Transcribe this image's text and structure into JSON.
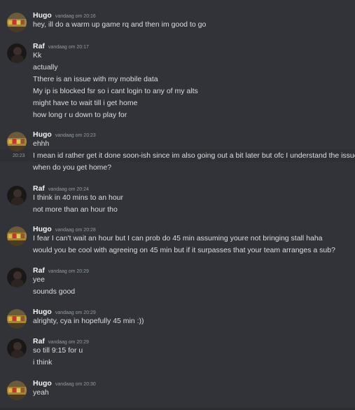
{
  "users": {
    "hugo": {
      "name": "Hugo",
      "avatar_icon": "hugo-avatar-icon"
    },
    "raf": {
      "name": "Raf",
      "avatar_icon": "raf-avatar-icon"
    }
  },
  "messages": [
    {
      "author": "Hugo",
      "timestamp": "vandaag om 20:16",
      "lines": [
        "hey, ill do a warm up game rq and then im good to go"
      ]
    },
    {
      "author": "Raf",
      "timestamp": "vandaag om 20:17",
      "lines": [
        "Kk",
        "actually",
        "Tthere is an issue with my mobile data",
        "My ip is blocked fsr so i cant login to any of my alts",
        "might have to wait till i get home",
        "how long r u down to play for"
      ]
    },
    {
      "author": "Hugo",
      "timestamp": "vandaag om 20:23",
      "lines": [
        "ehhh",
        "I mean id rather get it done soon-ish since im also going out a bit later but ofc I understand the issue",
        "when do you get home?"
      ],
      "hover_timestamp": "20:23"
    },
    {
      "author": "Raf",
      "timestamp": "vandaag om 20:24",
      "lines": [
        "I think in 40 mins to an hour",
        "not more than an hour tho"
      ]
    },
    {
      "author": "Hugo",
      "timestamp": "vandaag om 20:28",
      "lines": [
        "I fear I can't wait an hour but I can prob do 45 min assuming youre not bringing stall haha",
        "would you be cool with agreeing on 45 min but if it surpasses that your team arranges a sub?"
      ]
    },
    {
      "author": "Raf",
      "timestamp": "vandaag om 20:29",
      "lines": [
        "yee",
        "sounds good"
      ]
    },
    {
      "author": "Hugo",
      "timestamp": "vandaag om 20:29",
      "lines": [
        "alrighty, cya in hopefully 45 min :))"
      ]
    },
    {
      "author": "Raf",
      "timestamp": "vandaag om 20:29",
      "lines": [
        "so till 9:15 for u",
        "i think"
      ]
    },
    {
      "author": "Hugo",
      "timestamp": "vandaag om 20:30",
      "lines": [
        "yeah"
      ]
    }
  ],
  "colors": {
    "background": "#313338",
    "hover_background": "#2e3035",
    "username": "#f2f3f5",
    "message_text": "#dbdee1",
    "timestamp": "#949ba4"
  }
}
